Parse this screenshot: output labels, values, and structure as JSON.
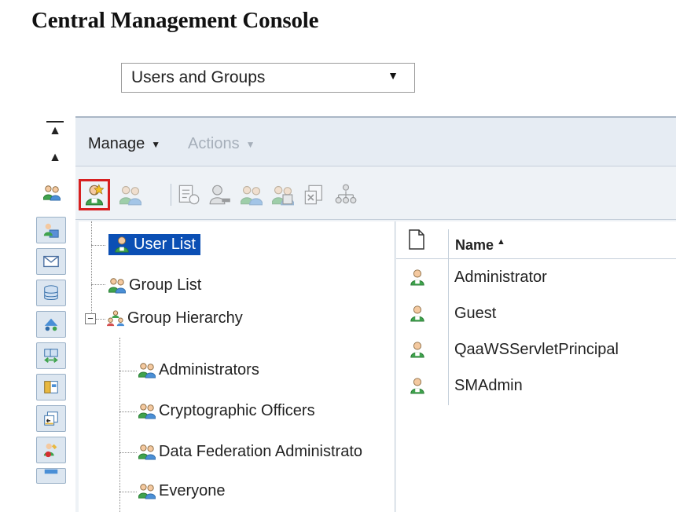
{
  "page": {
    "title": "Central Management Console"
  },
  "nav_select": {
    "selected": "Users and Groups",
    "arrow": "▼"
  },
  "menubar": {
    "manage": "Manage",
    "actions": "Actions",
    "caret": "▼"
  },
  "toolbar": {
    "buttons": [
      {
        "icon": "new-user-icon",
        "highlighted": true
      },
      {
        "icon": "new-group-icon"
      },
      {
        "icon": "properties-icon"
      },
      {
        "icon": "remove-user-icon"
      },
      {
        "icon": "add-members-icon"
      },
      {
        "icon": "join-group-icon"
      },
      {
        "icon": "delete-icon"
      },
      {
        "icon": "hierarchy-icon"
      }
    ]
  },
  "tree": {
    "user_list": "User List",
    "group_list": "Group List",
    "group_hierarchy": "Group Hierarchy",
    "expander": "−",
    "children": [
      "Administrators",
      "Cryptographic Officers",
      "Data Federation Administrato",
      "Everyone"
    ]
  },
  "grid": {
    "header": {
      "name": "Name",
      "sort_indicator": "▲"
    },
    "rows": [
      "Administrator",
      "Guest",
      "QaaWSServletPrincipal",
      "SMAdmin"
    ]
  },
  "colors": {
    "selection": "#0b4fb4",
    "highlight_border": "#d72020",
    "user_icon": "#3fa34d"
  }
}
